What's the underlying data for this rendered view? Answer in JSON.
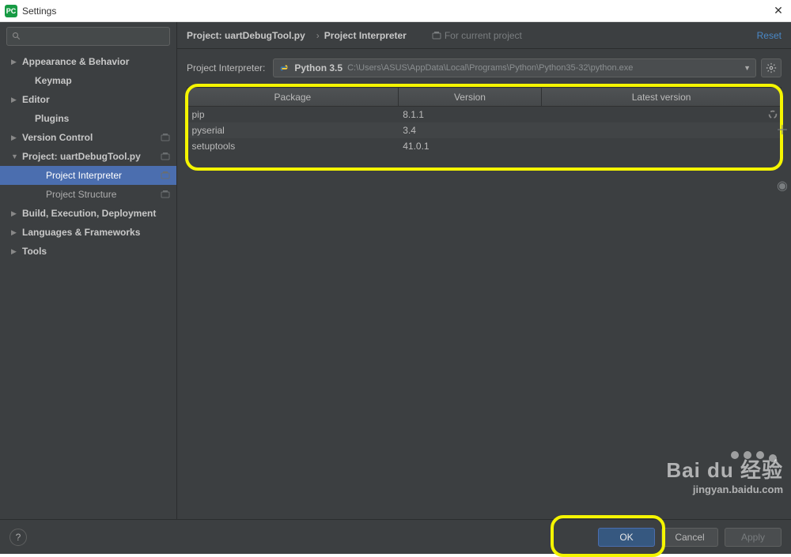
{
  "titlebar": {
    "title": "Settings"
  },
  "sidebar": {
    "items": [
      {
        "label": "Appearance & Behavior",
        "expander": "▶",
        "bold": true
      },
      {
        "label": "Keymap",
        "bold": true,
        "sub": true
      },
      {
        "label": "Editor",
        "expander": "▶",
        "bold": true
      },
      {
        "label": "Plugins",
        "bold": true,
        "sub": true
      },
      {
        "label": "Version Control",
        "expander": "▶",
        "bold": true,
        "badge": true
      },
      {
        "label": "Project: uartDebugTool.py",
        "expander": "▼",
        "bold": true,
        "badge": true
      },
      {
        "label": "Project Interpreter",
        "subsub": true,
        "selected": true,
        "badge": true
      },
      {
        "label": "Project Structure",
        "subsub": true,
        "badge": true
      },
      {
        "label": "Build, Execution, Deployment",
        "expander": "▶",
        "bold": true
      },
      {
        "label": "Languages & Frameworks",
        "expander": "▶",
        "bold": true
      },
      {
        "label": "Tools",
        "expander": "▶",
        "bold": true
      }
    ]
  },
  "header": {
    "crumb1": "Project: uartDebugTool.py",
    "crumb2": "Project Interpreter",
    "for_current": "For current project",
    "reset": "Reset"
  },
  "interpreter": {
    "label": "Project Interpreter:",
    "name": "Python 3.5",
    "path": "C:\\Users\\ASUS\\AppData\\Local\\Programs\\Python\\Python35-32\\python.exe"
  },
  "packages": {
    "columns": [
      "Package",
      "Version",
      "Latest version"
    ],
    "rows": [
      {
        "name": "pip",
        "version": "8.1.1",
        "latest": ""
      },
      {
        "name": "pyserial",
        "version": "3.4",
        "latest": ""
      },
      {
        "name": "setuptools",
        "version": "41.0.1",
        "latest": ""
      }
    ]
  },
  "footer": {
    "ok": "OK",
    "cancel": "Cancel",
    "apply": "Apply"
  },
  "watermark": {
    "logo": "Bai du 经验",
    "sub": "jingyan.baidu.com"
  }
}
